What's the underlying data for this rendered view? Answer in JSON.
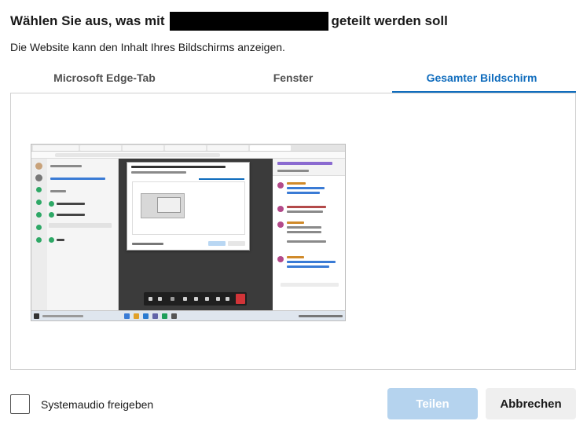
{
  "dialog": {
    "title_part1": "Wählen Sie aus, was mit",
    "title_part2": "geteilt werden soll",
    "subtitle": "Die Website kann den Inhalt Ihres Bildschirms anzeigen."
  },
  "tabs": [
    {
      "label": "Microsoft Edge-Tab",
      "active": false
    },
    {
      "label": "Fenster",
      "active": false
    },
    {
      "label": "Gesamter Bildschirm",
      "active": true
    }
  ],
  "footer": {
    "system_audio_label": "Systemaudio freigeben",
    "system_audio_checked": false,
    "share_label": "Teilen",
    "share_enabled": false,
    "cancel_label": "Abbrechen"
  },
  "colors": {
    "accent": "#0f6cbd",
    "share_disabled_bg": "#b5d3ee",
    "cancel_bg": "#efefef"
  }
}
